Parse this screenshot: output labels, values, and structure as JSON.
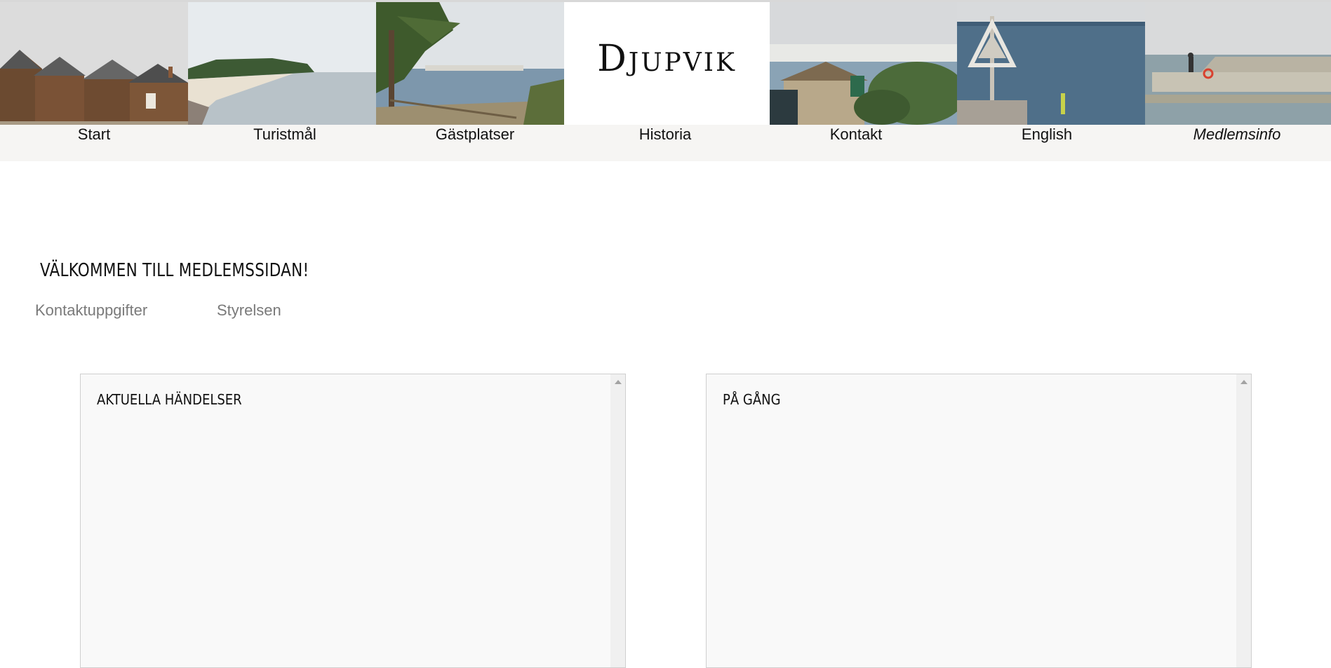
{
  "site": {
    "logo": "Djupvik"
  },
  "nav": {
    "items": [
      {
        "label": "Start"
      },
      {
        "label": "Turistmål"
      },
      {
        "label": "Gästplatser"
      },
      {
        "label": "Historia"
      },
      {
        "label": "Kontakt"
      },
      {
        "label": "English"
      },
      {
        "label": "Medlemsinfo"
      }
    ]
  },
  "main": {
    "heading": "VÄLKOMMEN TILL MEDLEMSSIDAN!",
    "links": [
      {
        "label": "Kontaktuppgifter"
      },
      {
        "label": "Styrelsen"
      }
    ],
    "panels": [
      {
        "title": "AKTUELLA HÄNDELSER"
      },
      {
        "title": "PÅ GÅNG"
      }
    ]
  },
  "colors": {
    "navbar_bg": "#f6f5f3",
    "panel_bg": "#f9f9f9",
    "link_gray": "#7a7a7a"
  }
}
